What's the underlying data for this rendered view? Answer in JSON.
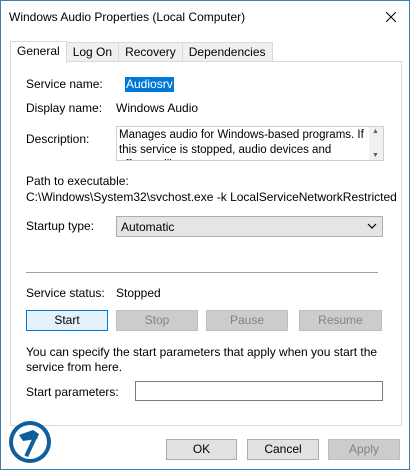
{
  "window": {
    "title": "Windows Audio Properties (Local Computer)"
  },
  "tabs": [
    {
      "label": "General"
    },
    {
      "label": "Log On"
    },
    {
      "label": "Recovery"
    },
    {
      "label": "Dependencies"
    }
  ],
  "general": {
    "service_name_label": "Service name:",
    "service_name_value": "Audiosrv",
    "display_name_label": "Display name:",
    "display_name_value": "Windows Audio",
    "description_label": "Description:",
    "description_value": "Manages audio for Windows-based programs.  If this service is stopped, audio devices and effects will not",
    "path_label": "Path to executable:",
    "path_value": "C:\\Windows\\System32\\svchost.exe -k LocalServiceNetworkRestricted",
    "startup_type_label": "Startup type:",
    "startup_type_value": "Automatic",
    "service_status_label": "Service status:",
    "service_status_value": "Stopped",
    "buttons": {
      "start": "Start",
      "stop": "Stop",
      "pause": "Pause",
      "resume": "Resume"
    },
    "info_text": "You can specify the start parameters that apply when you start the service from here.",
    "start_params_label": "Start parameters:",
    "start_params_value": ""
  },
  "footer": {
    "ok": "OK",
    "cancel": "Cancel",
    "apply": "Apply"
  },
  "colors": {
    "accent": "#0078d7",
    "border": "#3c7fb1",
    "logo_blue": "#0f5f9e"
  }
}
